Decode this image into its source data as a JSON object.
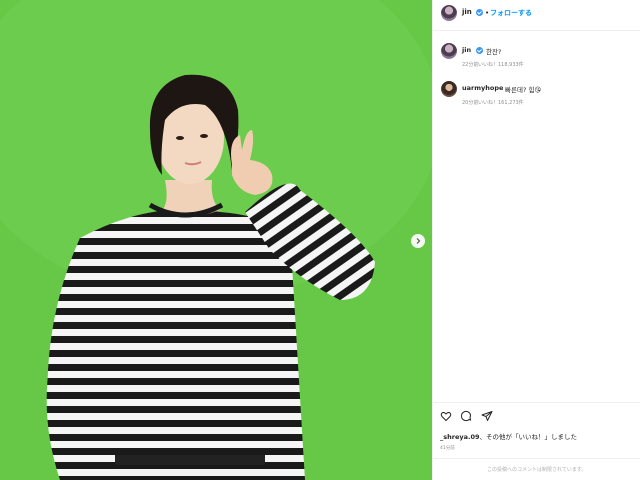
{
  "post": {
    "username": "jin",
    "follow_label": "フォローする",
    "separator": "•"
  },
  "comments": [
    {
      "username": "jin",
      "text": "한잔?",
      "time": "22分前",
      "likes": "いいね！118,933件"
    },
    {
      "username": "uarmyhope",
      "text": "빠른데? 힘😘",
      "time": "20分前",
      "likes": "いいね！161,273件"
    }
  ],
  "likes": {
    "user": "_shreya.09",
    "text": "その他が「いいね！」しました",
    "connector": "、",
    "time": "41分前"
  },
  "footer": {
    "comments_disabled": "この投稿へのコメントは制限されています。"
  },
  "icons": {
    "like": "heart-icon",
    "comment": "comment-icon",
    "share": "share-icon",
    "next": "chevron-right-icon"
  },
  "colors": {
    "background": "#67c848",
    "accent": "#0095f6",
    "verified": "#3897f0"
  }
}
